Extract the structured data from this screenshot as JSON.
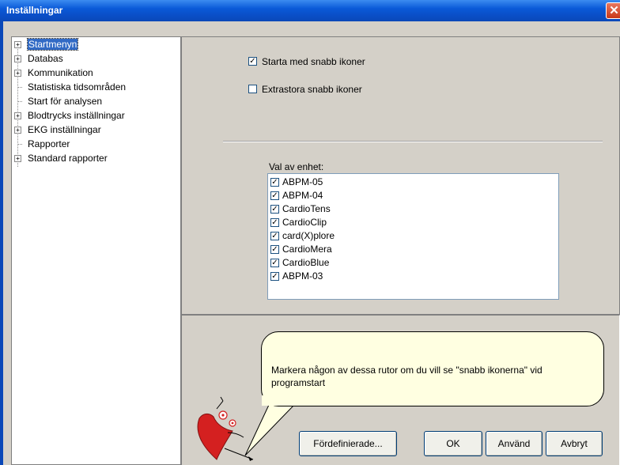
{
  "window": {
    "title": "Inställningar",
    "close_glyph": "✕"
  },
  "tree": {
    "items": [
      {
        "label": "Startmenyn",
        "expander": "+",
        "selected": true
      },
      {
        "label": "Databas",
        "expander": "+"
      },
      {
        "label": "Kommunikation",
        "expander": "+"
      },
      {
        "label": "Statistiska tidsområden",
        "expander": ""
      },
      {
        "label": "Start för analysen",
        "expander": ""
      },
      {
        "label": "Blodtrycks inställningar",
        "expander": "+"
      },
      {
        "label": "EKG inställningar",
        "expander": "+"
      },
      {
        "label": "Rapporter",
        "expander": ""
      },
      {
        "label": "Standard rapporter",
        "expander": "+"
      }
    ]
  },
  "options": {
    "quick_icons": {
      "label": "Starta med snabb ikoner",
      "checked": true
    },
    "large_icons": {
      "label": "Extrastora snabb ikoner",
      "checked": false
    }
  },
  "units": {
    "label": "Val av enhet:",
    "items": [
      {
        "label": "ABPM-05",
        "checked": true
      },
      {
        "label": "ABPM-04",
        "checked": true
      },
      {
        "label": "CardioTens",
        "checked": true
      },
      {
        "label": "CardioClip",
        "checked": true
      },
      {
        "label": "card(X)plore",
        "checked": true
      },
      {
        "label": "CardioMera",
        "checked": true
      },
      {
        "label": "CardioBlue",
        "checked": true
      },
      {
        "label": "ABPM-03",
        "checked": true
      }
    ]
  },
  "help": {
    "text": "Markera någon av dessa rutor om du vill se \"snabb ikonerna\" vid programstart"
  },
  "buttons": {
    "predefined": "Fördefinierade...",
    "ok": "OK",
    "apply": "Använd",
    "cancel": "Avbryt"
  },
  "check_glyph": "✓",
  "colors": {
    "titlebar": "#0a5ad8",
    "selection": "#316ac5",
    "tooltip_bg": "#ffffe1",
    "mascot_red": "#d42020"
  }
}
